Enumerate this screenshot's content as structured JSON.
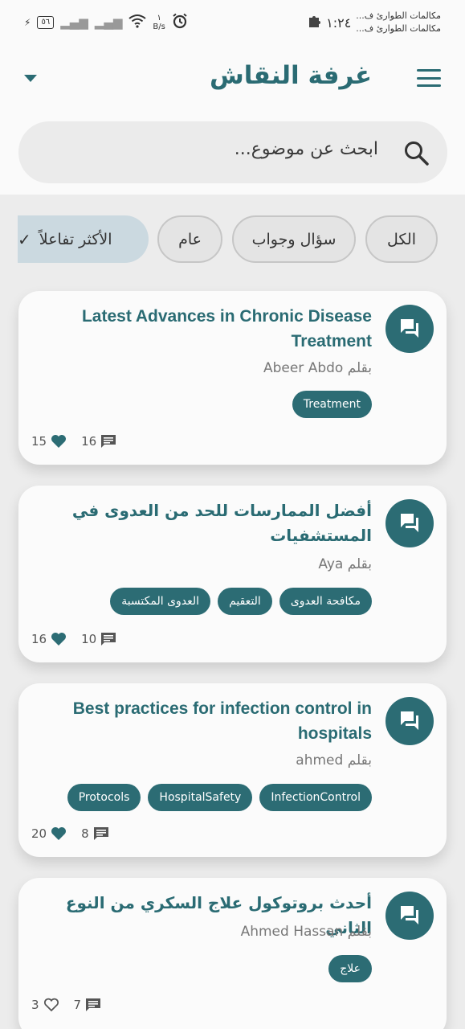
{
  "status_bar": {
    "battery": "٥٦",
    "speed_value": "١",
    "speed_unit": "B/s",
    "time": "١:٢٤",
    "notifications": [
      "مكالمات الطوارئ ف...",
      "مكالمات الطوارئ ف..."
    ]
  },
  "header": {
    "title": "غرفة النقاش"
  },
  "search": {
    "placeholder": "ابحث عن موضوع..."
  },
  "filters": [
    {
      "label": "الكل",
      "selected": false
    },
    {
      "label": "سؤال وجواب",
      "selected": false
    },
    {
      "label": "عام",
      "selected": false
    },
    {
      "label": "الأكثر تفاعلاً",
      "selected": true
    }
  ],
  "posts": [
    {
      "title": "Latest Advances in Chronic Disease Treatment",
      "author": "بقلم Abeer Abdo",
      "tags": [
        "Treatment"
      ],
      "likes": "15",
      "comments": "16",
      "liked": true
    },
    {
      "title": "أفضل الممارسات للحد من العدوى في المستشفيات",
      "author": "بقلم Aya",
      "tags": [
        "مكافحة العدوى",
        "التعقيم",
        "العدوى المكتسبة"
      ],
      "likes": "16",
      "comments": "10",
      "liked": true
    },
    {
      "title": "Best practices for infection control in hospitals",
      "author": "بقلم ahmed",
      "tags": [
        "InfectionControl",
        "HospitalSafety",
        "Protocols"
      ],
      "likes": "20",
      "comments": "8",
      "liked": true
    },
    {
      "title": "أحدث بروتوكول علاج السكري من النوع الثاني",
      "author": "بقلم Ahmed Hassan",
      "tags": [
        "علاج"
      ],
      "likes": "3",
      "comments": "7",
      "liked": false
    }
  ],
  "colors": {
    "primary": "#2c6c74",
    "background": "#ececec",
    "card": "#fbfbfb",
    "chip_selected": "#cbd9e0"
  }
}
